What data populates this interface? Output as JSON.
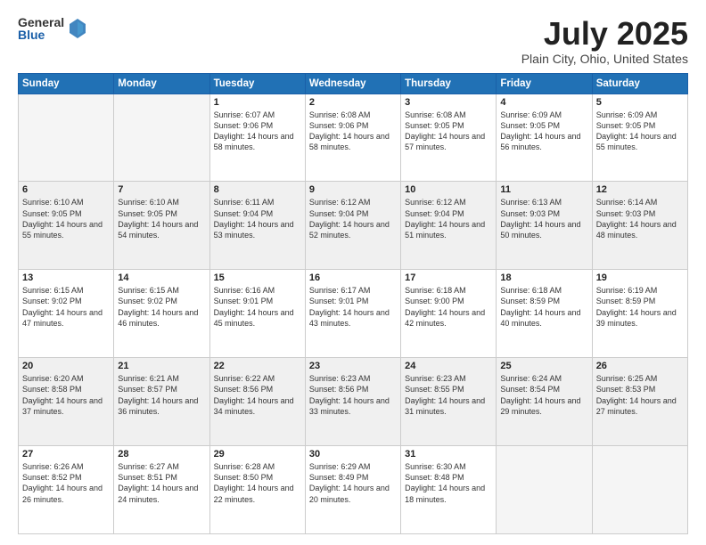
{
  "header": {
    "logo_general": "General",
    "logo_blue": "Blue",
    "month_title": "July 2025",
    "location": "Plain City, Ohio, United States"
  },
  "weekdays": [
    "Sunday",
    "Monday",
    "Tuesday",
    "Wednesday",
    "Thursday",
    "Friday",
    "Saturday"
  ],
  "weeks": [
    [
      {
        "day": "",
        "empty": true
      },
      {
        "day": "",
        "empty": true
      },
      {
        "day": "1",
        "sunrise": "Sunrise: 6:07 AM",
        "sunset": "Sunset: 9:06 PM",
        "daylight": "Daylight: 14 hours and 58 minutes."
      },
      {
        "day": "2",
        "sunrise": "Sunrise: 6:08 AM",
        "sunset": "Sunset: 9:06 PM",
        "daylight": "Daylight: 14 hours and 58 minutes."
      },
      {
        "day": "3",
        "sunrise": "Sunrise: 6:08 AM",
        "sunset": "Sunset: 9:05 PM",
        "daylight": "Daylight: 14 hours and 57 minutes."
      },
      {
        "day": "4",
        "sunrise": "Sunrise: 6:09 AM",
        "sunset": "Sunset: 9:05 PM",
        "daylight": "Daylight: 14 hours and 56 minutes."
      },
      {
        "day": "5",
        "sunrise": "Sunrise: 6:09 AM",
        "sunset": "Sunset: 9:05 PM",
        "daylight": "Daylight: 14 hours and 55 minutes."
      }
    ],
    [
      {
        "day": "6",
        "sunrise": "Sunrise: 6:10 AM",
        "sunset": "Sunset: 9:05 PM",
        "daylight": "Daylight: 14 hours and 55 minutes."
      },
      {
        "day": "7",
        "sunrise": "Sunrise: 6:10 AM",
        "sunset": "Sunset: 9:05 PM",
        "daylight": "Daylight: 14 hours and 54 minutes."
      },
      {
        "day": "8",
        "sunrise": "Sunrise: 6:11 AM",
        "sunset": "Sunset: 9:04 PM",
        "daylight": "Daylight: 14 hours and 53 minutes."
      },
      {
        "day": "9",
        "sunrise": "Sunrise: 6:12 AM",
        "sunset": "Sunset: 9:04 PM",
        "daylight": "Daylight: 14 hours and 52 minutes."
      },
      {
        "day": "10",
        "sunrise": "Sunrise: 6:12 AM",
        "sunset": "Sunset: 9:04 PM",
        "daylight": "Daylight: 14 hours and 51 minutes."
      },
      {
        "day": "11",
        "sunrise": "Sunrise: 6:13 AM",
        "sunset": "Sunset: 9:03 PM",
        "daylight": "Daylight: 14 hours and 50 minutes."
      },
      {
        "day": "12",
        "sunrise": "Sunrise: 6:14 AM",
        "sunset": "Sunset: 9:03 PM",
        "daylight": "Daylight: 14 hours and 48 minutes."
      }
    ],
    [
      {
        "day": "13",
        "sunrise": "Sunrise: 6:15 AM",
        "sunset": "Sunset: 9:02 PM",
        "daylight": "Daylight: 14 hours and 47 minutes."
      },
      {
        "day": "14",
        "sunrise": "Sunrise: 6:15 AM",
        "sunset": "Sunset: 9:02 PM",
        "daylight": "Daylight: 14 hours and 46 minutes."
      },
      {
        "day": "15",
        "sunrise": "Sunrise: 6:16 AM",
        "sunset": "Sunset: 9:01 PM",
        "daylight": "Daylight: 14 hours and 45 minutes."
      },
      {
        "day": "16",
        "sunrise": "Sunrise: 6:17 AM",
        "sunset": "Sunset: 9:01 PM",
        "daylight": "Daylight: 14 hours and 43 minutes."
      },
      {
        "day": "17",
        "sunrise": "Sunrise: 6:18 AM",
        "sunset": "Sunset: 9:00 PM",
        "daylight": "Daylight: 14 hours and 42 minutes."
      },
      {
        "day": "18",
        "sunrise": "Sunrise: 6:18 AM",
        "sunset": "Sunset: 8:59 PM",
        "daylight": "Daylight: 14 hours and 40 minutes."
      },
      {
        "day": "19",
        "sunrise": "Sunrise: 6:19 AM",
        "sunset": "Sunset: 8:59 PM",
        "daylight": "Daylight: 14 hours and 39 minutes."
      }
    ],
    [
      {
        "day": "20",
        "sunrise": "Sunrise: 6:20 AM",
        "sunset": "Sunset: 8:58 PM",
        "daylight": "Daylight: 14 hours and 37 minutes."
      },
      {
        "day": "21",
        "sunrise": "Sunrise: 6:21 AM",
        "sunset": "Sunset: 8:57 PM",
        "daylight": "Daylight: 14 hours and 36 minutes."
      },
      {
        "day": "22",
        "sunrise": "Sunrise: 6:22 AM",
        "sunset": "Sunset: 8:56 PM",
        "daylight": "Daylight: 14 hours and 34 minutes."
      },
      {
        "day": "23",
        "sunrise": "Sunrise: 6:23 AM",
        "sunset": "Sunset: 8:56 PM",
        "daylight": "Daylight: 14 hours and 33 minutes."
      },
      {
        "day": "24",
        "sunrise": "Sunrise: 6:23 AM",
        "sunset": "Sunset: 8:55 PM",
        "daylight": "Daylight: 14 hours and 31 minutes."
      },
      {
        "day": "25",
        "sunrise": "Sunrise: 6:24 AM",
        "sunset": "Sunset: 8:54 PM",
        "daylight": "Daylight: 14 hours and 29 minutes."
      },
      {
        "day": "26",
        "sunrise": "Sunrise: 6:25 AM",
        "sunset": "Sunset: 8:53 PM",
        "daylight": "Daylight: 14 hours and 27 minutes."
      }
    ],
    [
      {
        "day": "27",
        "sunrise": "Sunrise: 6:26 AM",
        "sunset": "Sunset: 8:52 PM",
        "daylight": "Daylight: 14 hours and 26 minutes."
      },
      {
        "day": "28",
        "sunrise": "Sunrise: 6:27 AM",
        "sunset": "Sunset: 8:51 PM",
        "daylight": "Daylight: 14 hours and 24 minutes."
      },
      {
        "day": "29",
        "sunrise": "Sunrise: 6:28 AM",
        "sunset": "Sunset: 8:50 PM",
        "daylight": "Daylight: 14 hours and 22 minutes."
      },
      {
        "day": "30",
        "sunrise": "Sunrise: 6:29 AM",
        "sunset": "Sunset: 8:49 PM",
        "daylight": "Daylight: 14 hours and 20 minutes."
      },
      {
        "day": "31",
        "sunrise": "Sunrise: 6:30 AM",
        "sunset": "Sunset: 8:48 PM",
        "daylight": "Daylight: 14 hours and 18 minutes."
      },
      {
        "day": "",
        "empty": true
      },
      {
        "day": "",
        "empty": true
      }
    ]
  ]
}
